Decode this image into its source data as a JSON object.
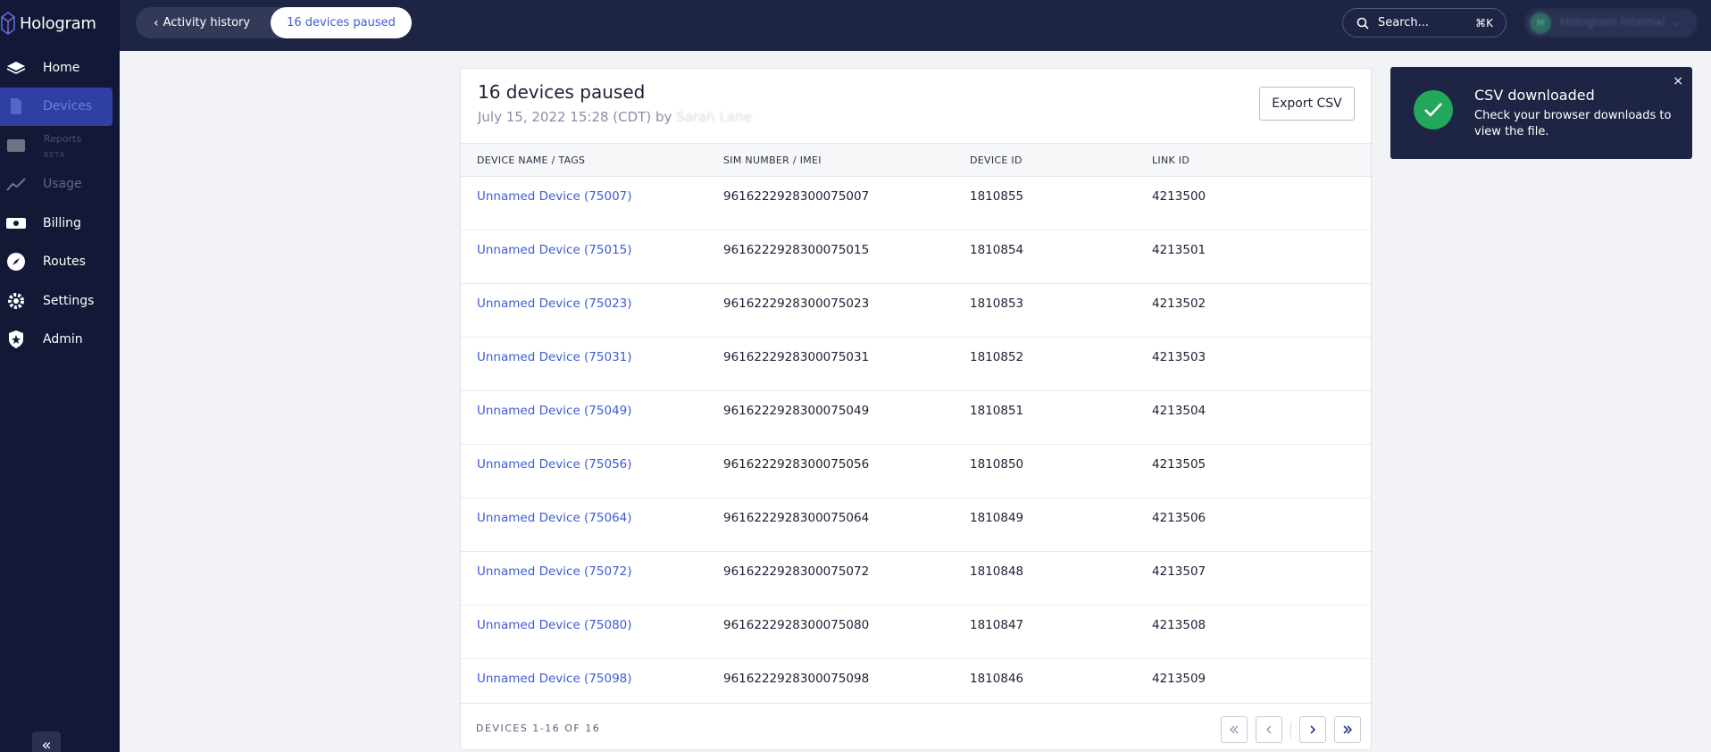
{
  "app": {
    "logo_text": "Hologram"
  },
  "sidebar": {
    "items": [
      {
        "label": "Home",
        "icon": "home-icon"
      },
      {
        "label": "Devices",
        "icon": "devices-icon",
        "active": true
      },
      {
        "label": "Reports",
        "badge": "BETA",
        "icon": "reports-icon"
      },
      {
        "label": "Usage",
        "icon": "usage-icon"
      },
      {
        "label": "Billing",
        "icon": "billing-icon"
      },
      {
        "label": "Routes",
        "icon": "routes-icon"
      },
      {
        "label": "Settings",
        "icon": "gear-icon"
      },
      {
        "label": "Admin",
        "icon": "admin-icon"
      }
    ],
    "collapse_label": "«"
  },
  "topbar": {
    "breadcrumb_back": "Activity history",
    "breadcrumb_current": "16 devices paused",
    "search_label": "Search...",
    "search_shortcut": "⌘K",
    "account_initial": "H",
    "account_name": "Hologram Internal"
  },
  "card": {
    "title": "16 devices paused",
    "subtitle_date": "July 15, 2022 15:28 (CDT) by",
    "subtitle_user": "Sarah Lane",
    "export_label": "Export CSV",
    "columns": [
      "DEVICE NAME / TAGS",
      "SIM NUMBER / IMEI",
      "DEVICE ID",
      "LINK ID"
    ],
    "rows": [
      {
        "name": "Unnamed Device (75007)",
        "sim": "9616222928300075007",
        "device_id": "1810855",
        "link_id": "4213500"
      },
      {
        "name": "Unnamed Device (75015)",
        "sim": "9616222928300075015",
        "device_id": "1810854",
        "link_id": "4213501"
      },
      {
        "name": "Unnamed Device (75023)",
        "sim": "9616222928300075023",
        "device_id": "1810853",
        "link_id": "4213502"
      },
      {
        "name": "Unnamed Device (75031)",
        "sim": "9616222928300075031",
        "device_id": "1810852",
        "link_id": "4213503"
      },
      {
        "name": "Unnamed Device (75049)",
        "sim": "9616222928300075049",
        "device_id": "1810851",
        "link_id": "4213504"
      },
      {
        "name": "Unnamed Device (75056)",
        "sim": "9616222928300075056",
        "device_id": "1810850",
        "link_id": "4213505"
      },
      {
        "name": "Unnamed Device (75064)",
        "sim": "9616222928300075064",
        "device_id": "1810849",
        "link_id": "4213506"
      },
      {
        "name": "Unnamed Device (75072)",
        "sim": "9616222928300075072",
        "device_id": "1810848",
        "link_id": "4213507"
      },
      {
        "name": "Unnamed Device (75080)",
        "sim": "9616222928300075080",
        "device_id": "1810847",
        "link_id": "4213508"
      },
      {
        "name": "Unnamed Device (75098)",
        "sim": "9616222928300075098",
        "device_id": "1810846",
        "link_id": "4213509"
      }
    ],
    "footer_count": "DEVICES 1-16 OF 16"
  },
  "toast": {
    "title": "CSV downloaded",
    "body": "Check your browser downloads to view the file.",
    "close_label": "×"
  },
  "colors": {
    "sidebar_bg": "#121836",
    "topbar_bg": "#1d2444",
    "accent": "#3d5bd6",
    "success": "#23a75a"
  }
}
